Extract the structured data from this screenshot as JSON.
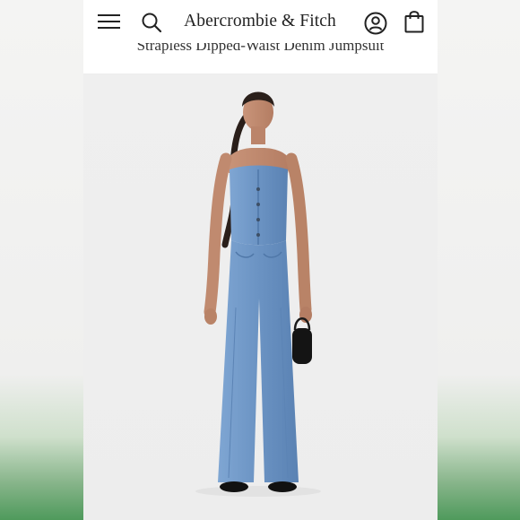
{
  "header": {
    "brand": "Abercrombie & Fitch",
    "icons": {
      "menu": "menu-icon",
      "search": "search-icon",
      "account": "account-icon",
      "bag": "shopping-bag-icon"
    }
  },
  "product": {
    "title": "Strapless Dipped-Waist Denim Jumpsuit"
  },
  "colors": {
    "denim": "#6a93c4",
    "background": "#efefef",
    "frame_green": "#5c9a63"
  }
}
